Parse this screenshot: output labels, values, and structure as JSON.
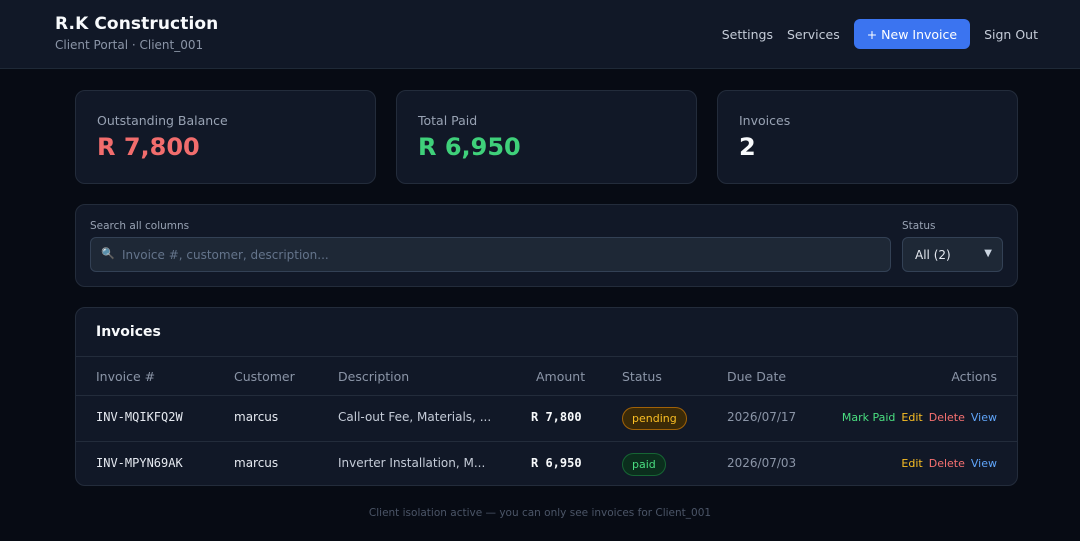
{
  "header": {
    "title": "R.K Construction",
    "subtitle": "Client Portal · Client_001",
    "nav": {
      "settings": "Settings",
      "services": "Services",
      "new_invoice": "+ New Invoice",
      "sign_out": "Sign Out"
    }
  },
  "stats": [
    {
      "label": "Outstanding Balance",
      "value": "R 7,800",
      "color": "#f26d6d"
    },
    {
      "label": "Total Paid",
      "value": "R 6,950",
      "color": "#3fd07a"
    },
    {
      "label": "Invoices",
      "value": "2",
      "color": "#f8fafc"
    }
  ],
  "filters": {
    "search_label": "Search all columns",
    "search_placeholder": "Invoice #, customer, description...",
    "search_value": "",
    "search_icon": "magnifier-icon",
    "status_label": "Status",
    "status_selected": "All (2)"
  },
  "table": {
    "title": "Invoices",
    "columns": [
      "Invoice #",
      "Customer",
      "Description",
      "Amount",
      "Status",
      "Due Date",
      "Actions"
    ],
    "rows": [
      {
        "invoice": "INV-MQIKFQ2W",
        "customer": "marcus",
        "description": "Call-out Fee, Materials, ...",
        "amount": "R 7,800",
        "status": "pending",
        "due": "2026/07/17",
        "actions": {
          "mark_paid": "Mark Paid",
          "edit": "Edit",
          "delete": "Delete",
          "view": "View"
        }
      },
      {
        "invoice": "INV-MPYN69AK",
        "customer": "marcus",
        "description": "Inverter Installation, M...",
        "amount": "R 6,950",
        "status": "paid",
        "due": "2026/07/03",
        "actions": {
          "edit": "Edit",
          "delete": "Delete",
          "view": "View"
        }
      }
    ]
  },
  "footer": {
    "note": "Client isolation active — you can only see invoices for Client_001"
  },
  "colors": {
    "background": "#070b14",
    "card": "#111827",
    "accent": "#3b74f0"
  }
}
